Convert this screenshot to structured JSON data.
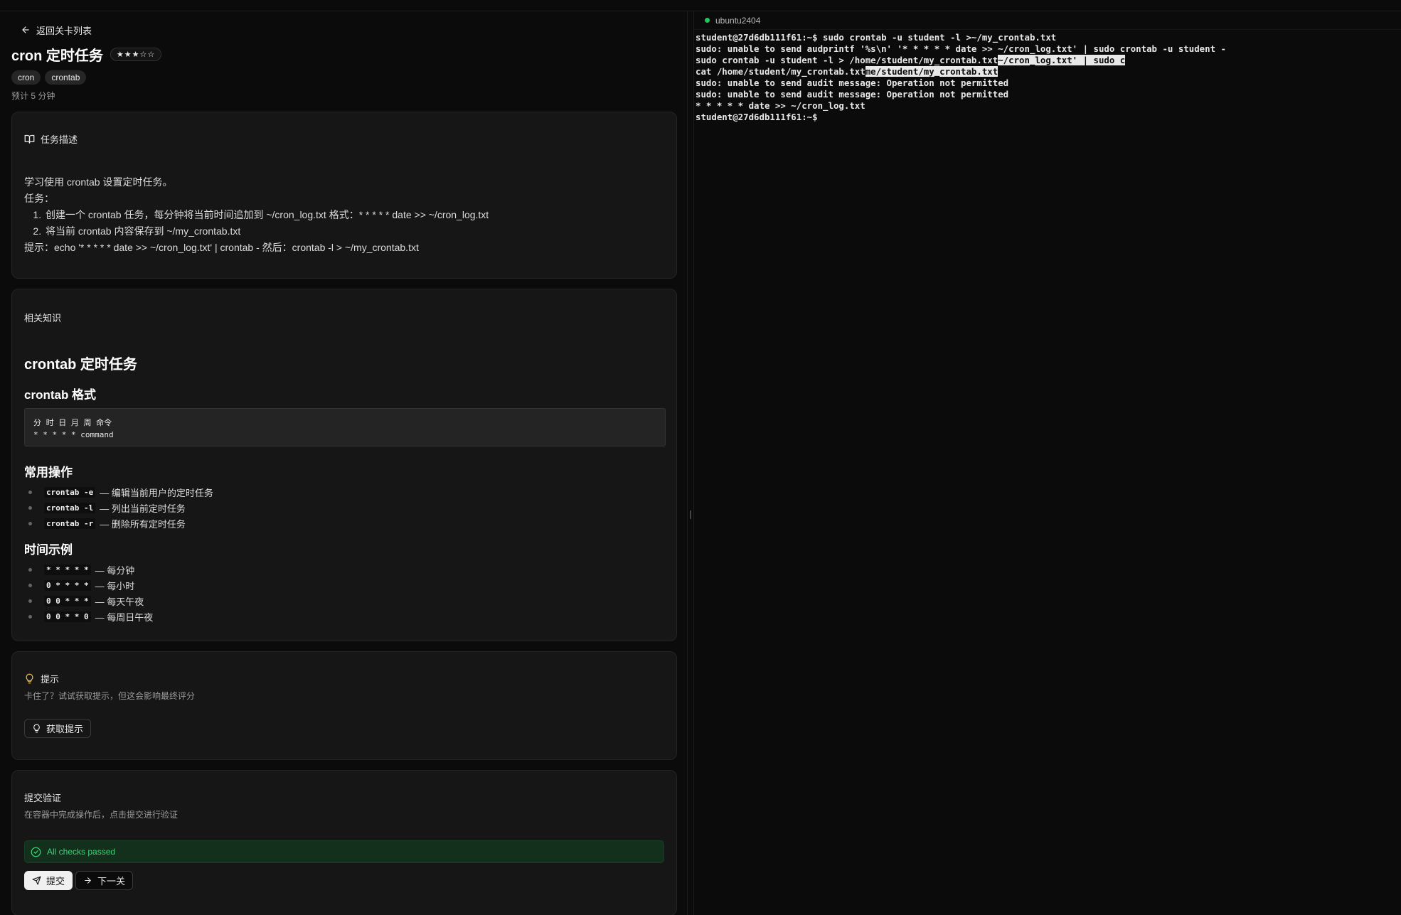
{
  "left": {
    "back_label": "返回关卡列表",
    "title": "cron 定时任务",
    "difficulty": "★★★☆☆",
    "tags": [
      "cron",
      "crontab"
    ],
    "estimate": "预计 5 分钟",
    "description": {
      "heading": "任务描述",
      "intro": "学习使用 crontab 设置定时任务。",
      "task_label": "任务：",
      "steps": [
        "创建一个 crontab 任务，每分钟将当前时间追加到 ~/cron_log.txt 格式：* * * * * date >> ~/cron_log.txt",
        "将当前 crontab 内容保存到 ~/my_crontab.txt"
      ],
      "tip": "提示：echo '* * * * * date >> ~/cron_log.txt' | crontab - 然后：crontab -l > ~/my_crontab.txt"
    },
    "knowledge": {
      "heading": "相关知识",
      "h1": "crontab 定时任务",
      "format_heading": "crontab 格式",
      "format_code_line1": "分 时 日 月 周 命令",
      "format_code_line2": "* * * * * command",
      "ops_heading": "常用操作",
      "ops": [
        {
          "code": "crontab -e",
          "text": "— 编辑当前用户的定时任务"
        },
        {
          "code": "crontab -l",
          "text": "— 列出当前定时任务"
        },
        {
          "code": "crontab -r",
          "text": "— 删除所有定时任务"
        }
      ],
      "examples_heading": "时间示例",
      "examples": [
        {
          "code": "* * * * *",
          "text": "— 每分钟"
        },
        {
          "code": "0 * * * *",
          "text": "— 每小时"
        },
        {
          "code": "0 0 * * *",
          "text": "— 每天午夜"
        },
        {
          "code": "0 0 * * 0",
          "text": "— 每周日午夜"
        }
      ]
    },
    "hint": {
      "heading": "提示",
      "subtitle": "卡住了？试试获取提示，但这会影响最终评分",
      "button": "获取提示"
    },
    "submit": {
      "heading": "提交验证",
      "subtitle": "在容器中完成操作后，点击提交进行验证",
      "status": "All checks passed",
      "submit_button": "提交",
      "next_button": "下一关"
    }
  },
  "terminal": {
    "host": "ubuntu2404",
    "lines": [
      {
        "pre": "student@27d6db111f61:~$ sudo crontab -u student -l >~/my_crontab.txt",
        "sel": "",
        "post": ""
      },
      {
        "pre": "sudo: unable to send audprintf '%s\\n' '* * * * * date >> ~/cron_log.txt' | sudo crontab -u student -",
        "sel": "",
        "post": ""
      },
      {
        "pre": "sudo crontab -u student -l > /home/student/my_crontab.txt",
        "sel": "~/cron_log.txt' | sudo c",
        "post": ""
      },
      {
        "pre": "cat /home/student/my_crontab.txt",
        "sel": "me/student/my_crontab.txt",
        "post": ""
      },
      {
        "pre": "sudo: unable to send audit message: Operation not permitted",
        "sel": "",
        "post": ""
      },
      {
        "pre": "sudo: unable to send audit message: Operation not permitted",
        "sel": "",
        "post": ""
      },
      {
        "pre": "* * * * * date >> ~/cron_log.txt",
        "sel": "",
        "post": ""
      },
      {
        "pre": "student@27d6db111f61:~$",
        "sel": "",
        "post": ""
      }
    ]
  }
}
